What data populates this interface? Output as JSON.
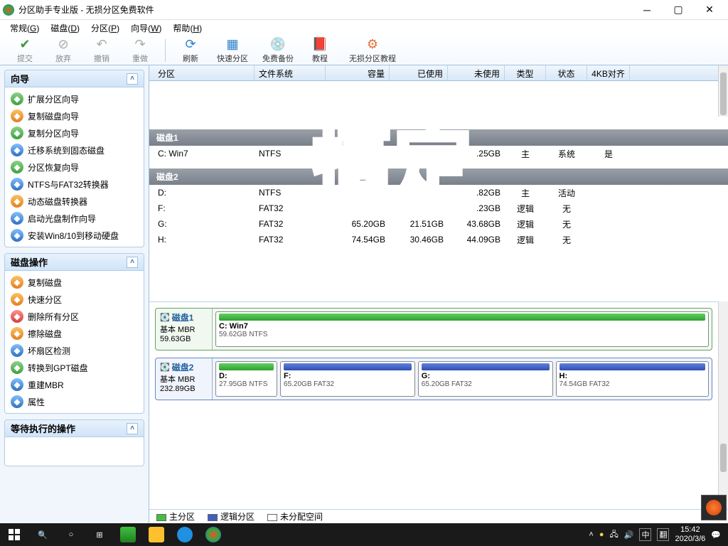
{
  "window": {
    "title": "分区助手专业版 - 无损分区免费软件"
  },
  "menubar": [
    {
      "label": "常规",
      "key": "G"
    },
    {
      "label": "磁盘",
      "key": "D"
    },
    {
      "label": "分区",
      "key": "P"
    },
    {
      "label": "向导",
      "key": "W"
    },
    {
      "label": "帮助",
      "key": "H"
    }
  ],
  "toolbar": {
    "commit": "提交",
    "discard": "放弃",
    "undo": "撤销",
    "redo": "重做",
    "refresh": "刷新",
    "quick": "快速分区",
    "backup": "免费备份",
    "tutorial": "教程",
    "lossless": "无损分区教程"
  },
  "left": {
    "wizard": {
      "title": "向导",
      "items": [
        {
          "name": "扩展分区向导",
          "icon": "i-green"
        },
        {
          "name": "复制磁盘向导",
          "icon": "i-orange"
        },
        {
          "name": "复制分区向导",
          "icon": "i-green"
        },
        {
          "name": "迁移系统到固态磁盘",
          "icon": "i-blue"
        },
        {
          "name": "分区恢复向导",
          "icon": "i-green"
        },
        {
          "name": "NTFS与FAT32转换器",
          "icon": "i-blue"
        },
        {
          "name": "动态磁盘转换器",
          "icon": "i-orange"
        },
        {
          "name": "启动光盘制作向导",
          "icon": "i-blue"
        },
        {
          "name": "安装Win8/10到移动硬盘",
          "icon": "i-blue"
        }
      ]
    },
    "diskops": {
      "title": "磁盘操作",
      "items": [
        {
          "name": "复制磁盘",
          "icon": "i-orange"
        },
        {
          "name": "快速分区",
          "icon": "i-orange"
        },
        {
          "name": "删除所有分区",
          "icon": "i-red"
        },
        {
          "name": "擦除磁盘",
          "icon": "i-orange"
        },
        {
          "name": "坏扇区检测",
          "icon": "i-blue"
        },
        {
          "name": "转换到GPT磁盘",
          "icon": "i-green"
        },
        {
          "name": "重建MBR",
          "icon": "i-blue"
        },
        {
          "name": "属性",
          "icon": "i-blue"
        }
      ]
    },
    "pending": {
      "title": "等待执行的操作"
    }
  },
  "columns": {
    "part": "分区",
    "fs": "文件系统",
    "cap": "容量",
    "used": "已使用",
    "free": "未使用",
    "type": "类型",
    "status": "状态",
    "align": "4KB对齐"
  },
  "disks": [
    {
      "header": "磁盘1",
      "rows": [
        {
          "part": "C: Win7",
          "fs": "NTFS",
          "cap": "",
          "used": "",
          "free": ".25GB",
          "type": "主",
          "status": "系统",
          "align": "是"
        }
      ]
    },
    {
      "header": "磁盘2",
      "rows": [
        {
          "part": "D:",
          "fs": "NTFS",
          "cap": "",
          "used": "",
          "free": ".82GB",
          "type": "主",
          "status": "活动",
          "align": ""
        },
        {
          "part": "F:",
          "fs": "FAT32",
          "cap": "",
          "used": "",
          "free": ".23GB",
          "type": "逻辑",
          "status": "无",
          "align": ""
        },
        {
          "part": "G:",
          "fs": "FAT32",
          "cap": "65.20GB",
          "used": "21.51GB",
          "free": "43.68GB",
          "type": "逻辑",
          "status": "无",
          "align": ""
        },
        {
          "part": "H:",
          "fs": "FAT32",
          "cap": "74.54GB",
          "used": "30.46GB",
          "free": "44.09GB",
          "type": "逻辑",
          "status": "无",
          "align": ""
        }
      ]
    }
  ],
  "maps": [
    {
      "name": "磁盘1",
      "sub1": "基本 MBR",
      "sub2": "59.63GB",
      "color": "green",
      "parts": [
        {
          "label": "C: Win7",
          "sub": "59.62GB NTFS",
          "bar": "bar-green",
          "flex": 1
        }
      ]
    },
    {
      "name": "磁盘2",
      "sub1": "基本 MBR",
      "sub2": "232.89GB",
      "color": "blue",
      "parts": [
        {
          "label": "D:",
          "sub": "27.95GB NTFS",
          "bar": "bar-green",
          "flex": 0.12
        },
        {
          "label": "F:",
          "sub": "65.20GB FAT32",
          "bar": "bar-blue",
          "flex": 0.28
        },
        {
          "label": "G:",
          "sub": "65.20GB FAT32",
          "bar": "bar-blue",
          "flex": 0.28
        },
        {
          "label": "H:",
          "sub": "74.54GB FAT32",
          "bar": "bar-blue",
          "flex": 0.32
        }
      ]
    }
  ],
  "legend": {
    "primary": "主分区",
    "logical": "逻辑分区",
    "unalloc": "未分配空间"
  },
  "overlay": "搞定",
  "taskbar": {
    "time": "15:42",
    "date": "2020/3/6",
    "ime1": "中",
    "ime2": "翻"
  }
}
